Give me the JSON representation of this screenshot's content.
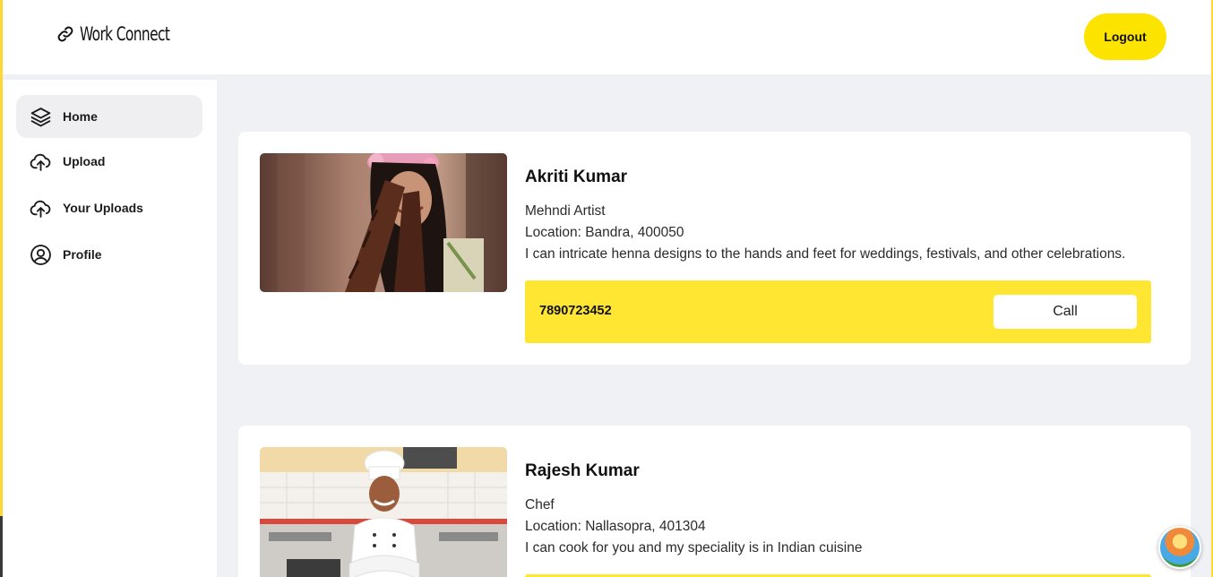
{
  "app": {
    "name": "Work Connect",
    "logout_label": "Logout"
  },
  "sidebar": {
    "items": [
      {
        "label": "Home",
        "icon": "layers-icon",
        "active": true
      },
      {
        "label": "Upload",
        "icon": "cloud-upload-icon",
        "active": false
      },
      {
        "label": "Your Uploads",
        "icon": "cloud-upload-icon",
        "active": false
      },
      {
        "label": "Profile",
        "icon": "user-circle-icon",
        "active": false
      }
    ]
  },
  "listings": [
    {
      "name": "Akriti Kumar",
      "profession": "Mehndi Artist",
      "location": "Location: Bandra, 400050",
      "description": "I can intricate henna designs to the hands and feet for weddings, festivals, and other celebrations.",
      "phone": "7890723452",
      "call_label": "Call"
    },
    {
      "name": "Rajesh Kumar",
      "profession": "Chef",
      "location": "Location: Nallasopra, 401304",
      "description": "I can cook for you and my speciality is in Indian cuisine"
    }
  ],
  "colors": {
    "accent": "#fde400",
    "contact_bar": "#ffe633",
    "page_bg": "#f0f1f4"
  }
}
